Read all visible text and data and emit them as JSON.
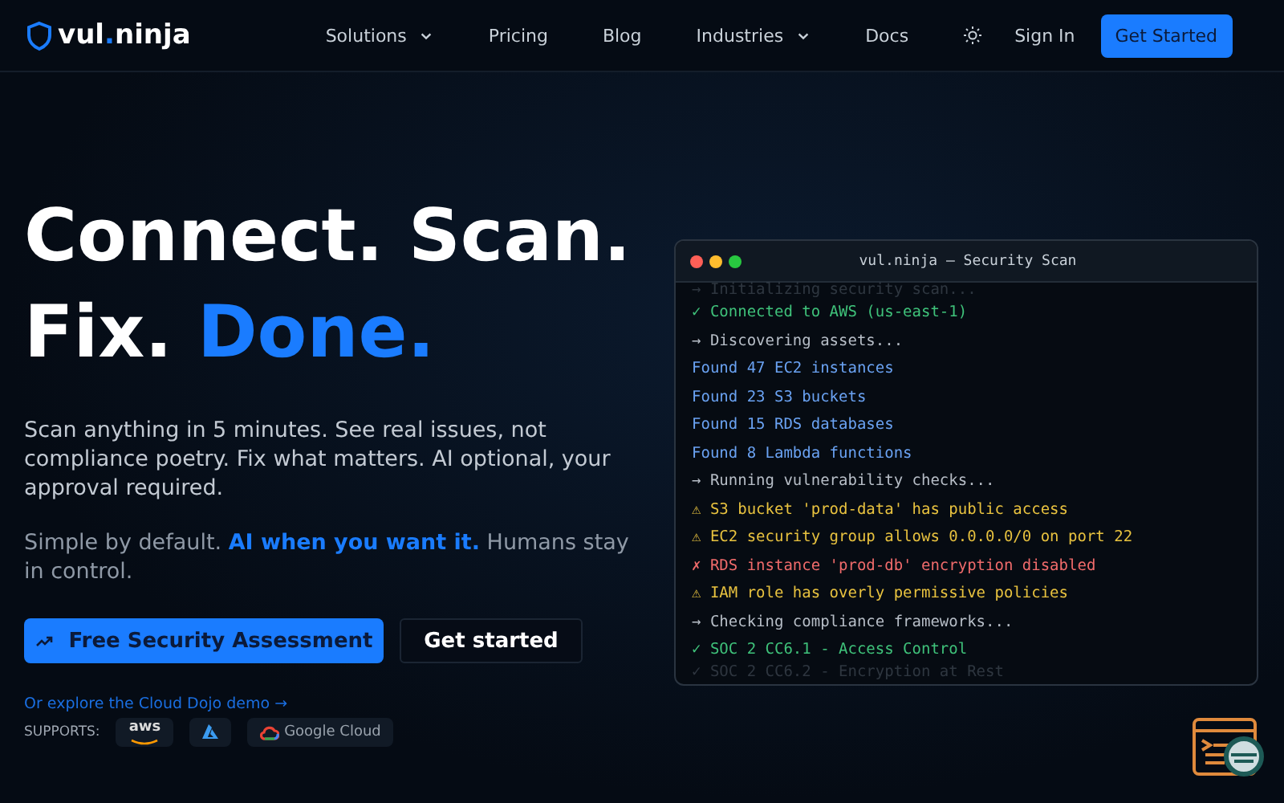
{
  "nav": {
    "logo_parts": [
      "vul",
      ".",
      "ninja"
    ],
    "links": [
      {
        "label": "Solutions",
        "dropdown": true
      },
      {
        "label": "Pricing",
        "dropdown": false
      },
      {
        "label": "Blog",
        "dropdown": false
      },
      {
        "label": "Industries",
        "dropdown": true
      },
      {
        "label": "Docs",
        "dropdown": false
      }
    ],
    "sign_in": "Sign In",
    "cta": "Get Started"
  },
  "hero": {
    "headline_1": "Connect. Scan.",
    "headline_2a": "Fix.",
    "headline_2b": "Done.",
    "lead": "Scan anything in 5 minutes. See real issues, not compliance poetry. Fix what matters. AI optional, your approval required.",
    "sub": "Simple by default. **AI when you want it.** Humans stay in control.",
    "primary": "Free Security Assessment",
    "secondary": "Get started",
    "demo_link": "Or explore the Cloud Dojo demo →",
    "supports": "SUPPORTS:",
    "providers": [
      {
        "kind": "aws",
        "label": "aws"
      },
      {
        "kind": "azure"
      },
      {
        "kind": "gcp",
        "label": "Google Cloud"
      }
    ]
  },
  "terminal": {
    "title": "vul.ninja — Security Scan",
    "lines": [
      {
        "kind": "faded",
        "text": "→ Initializing security scan..."
      },
      {
        "kind": "ok",
        "text": "✓ Connected to AWS (us-east-1)"
      },
      {
        "kind": "step",
        "text": "→ Discovering assets..."
      },
      {
        "kind": "found",
        "text": "Found 47 EC2 instances"
      },
      {
        "kind": "found",
        "text": "Found 23 S3 buckets"
      },
      {
        "kind": "found",
        "text": "Found 15 RDS databases"
      },
      {
        "kind": "found",
        "text": "Found 8 Lambda functions"
      },
      {
        "kind": "step",
        "text": "→ Running vulnerability checks..."
      },
      {
        "kind": "warn",
        "text": "⚠ S3 bucket 'prod-data' has public access"
      },
      {
        "kind": "warn",
        "text": "⚠ EC2 security group allows 0.0.0.0/0 on port 22"
      },
      {
        "kind": "error",
        "text": "✗ RDS instance 'prod-db' encryption disabled"
      },
      {
        "kind": "warn",
        "text": "⚠ IAM role has overly permissive policies"
      },
      {
        "kind": "step",
        "text": "→ Checking compliance frameworks..."
      },
      {
        "kind": "ok",
        "text": "✓ SOC 2 CC6.1 - Access Control"
      },
      {
        "kind": "faded",
        "text": "✓ SOC 2 CC6.2 - Encryption at Rest"
      }
    ]
  }
}
